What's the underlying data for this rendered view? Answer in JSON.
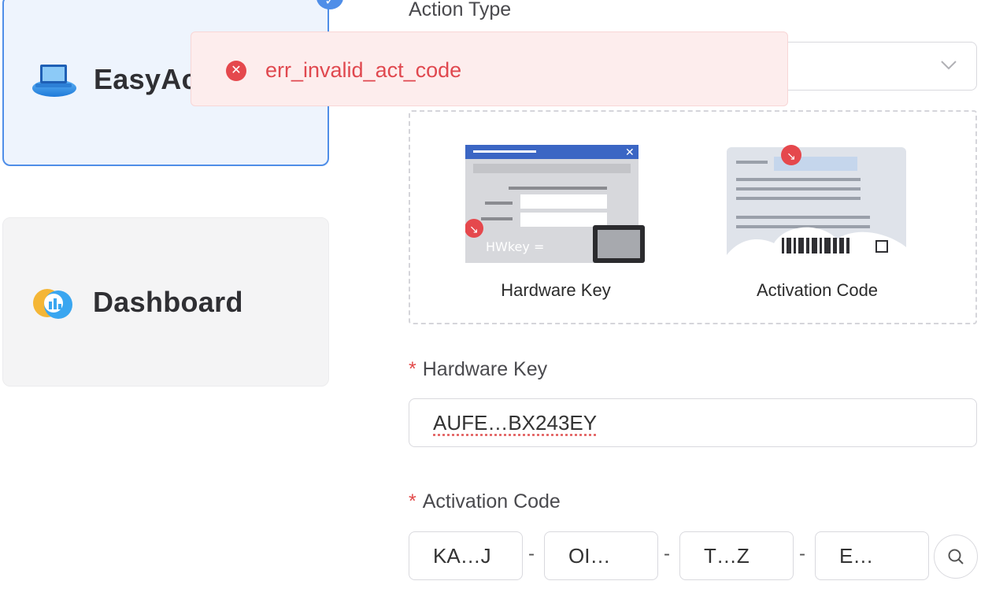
{
  "products": {
    "easy": {
      "name": "EasyAc"
    },
    "dashboard": {
      "name": "Dashboard"
    }
  },
  "form": {
    "action_type_label": "Action Type",
    "action_type_value": "",
    "options": [
      {
        "label": "Hardware Key",
        "image_text": "HWkey ="
      },
      {
        "label": "Activation Code"
      }
    ],
    "hardware_key_label": "Hardware Key",
    "hardware_key_value": "AUFE…BX243EY",
    "activation_code_label": "Activation Code",
    "activation_code_segments": [
      "KA…J",
      "OI…",
      "T…Z",
      "E…"
    ],
    "separator": "-",
    "required_mark": "*"
  },
  "toast": {
    "message": "err_invalid_act_code",
    "type": "error"
  },
  "colors": {
    "accent": "#4f8ee8",
    "error": "#e0484f",
    "toast_bg": "#fdeded"
  },
  "icons": [
    "check-icon",
    "laptop-cloud-icon",
    "dashboard-cloud-icon",
    "chevron-down-icon",
    "close-icon",
    "search-icon"
  ]
}
